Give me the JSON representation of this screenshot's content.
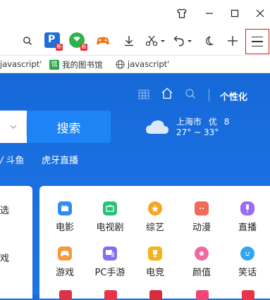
{
  "window": {
    "controls": [
      "shirt-icon",
      "minimize-icon",
      "maximize-icon",
      "close-icon"
    ]
  },
  "toolbar": {
    "ext_badge": "新",
    "icons": [
      "search-icon",
      "ext-p-icon",
      "ext-green-icon",
      "ext-game-icon",
      "download-icon",
      "scissors-icon",
      "undo-icon",
      "moon-icon",
      "plus-icon",
      "menu-icon"
    ]
  },
  "bookmarks": [
    {
      "label": "javascript'"
    },
    {
      "label": "我的图书馆"
    },
    {
      "label": "javascript'"
    }
  ],
  "header": {
    "personalize_label": "个性化"
  },
  "search": {
    "button_label": "搜索"
  },
  "weather": {
    "city": "上海市",
    "aqi": "优",
    "aqi_value": "8",
    "temp_range": "27° ~ 33°"
  },
  "hot_links": [
    "斗鱼",
    "虎牙直播"
  ],
  "left_card": [
    "选",
    "戏"
  ],
  "categories": [
    {
      "label": "电影",
      "icon": "film-icon",
      "color": "#2f8cf0"
    },
    {
      "label": "电视剧",
      "icon": "tv-icon",
      "color": "#2bc07a"
    },
    {
      "label": "综艺",
      "icon": "star-icon",
      "color": "#f5a623"
    },
    {
      "label": "动漫",
      "icon": "cat-icon",
      "color": "#f06a5a"
    },
    {
      "label": "直播",
      "icon": "mic-icon",
      "color": "#9b6cf0"
    },
    {
      "label": "游戏",
      "icon": "gamepad-icon",
      "color": "#f59a3a"
    },
    {
      "label": "PC手游",
      "icon": "pc-game-icon",
      "color": "#8a6cf0"
    },
    {
      "label": "电竞",
      "icon": "trophy-icon",
      "color": "#f5b21a"
    },
    {
      "label": "颜值",
      "icon": "girl-icon",
      "color": "#f06aa0"
    },
    {
      "label": "笑话",
      "icon": "smile-icon",
      "color": "#2fa8f0"
    }
  ],
  "colors": {
    "page_blue": "#1a6fe0",
    "search_button": "#1e83f4",
    "highlight_border": "#d62020"
  }
}
